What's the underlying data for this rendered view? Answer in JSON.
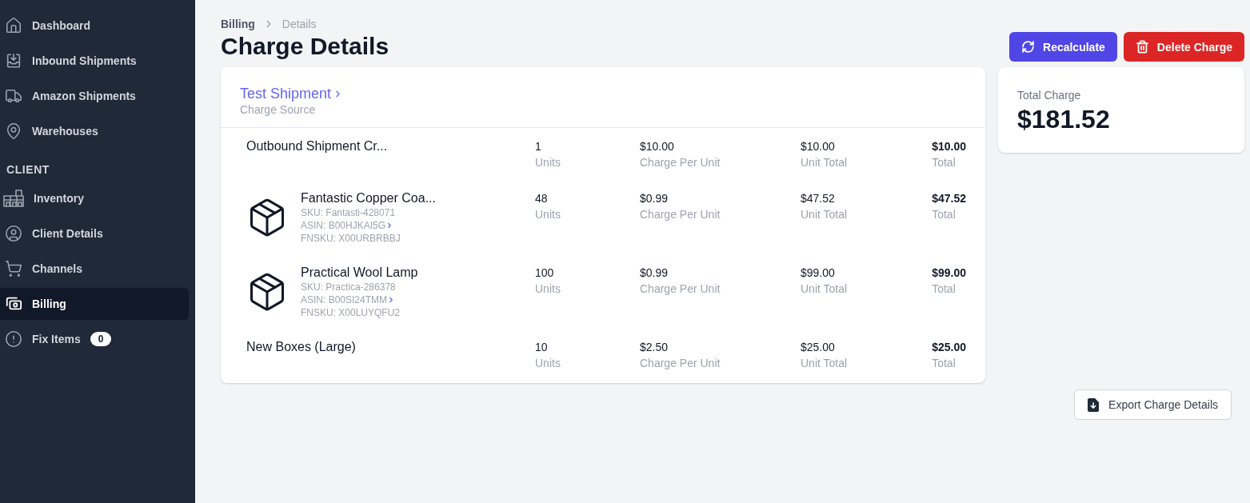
{
  "sidebar": {
    "groups": [
      {
        "items": [
          {
            "label": "Dashboard",
            "selected": false
          },
          {
            "label": "Inbound Shipments",
            "selected": false
          },
          {
            "label": "Amazon Shipments",
            "selected": false
          },
          {
            "label": "Warehouses",
            "selected": false
          }
        ]
      },
      {
        "heading": "CLIENT",
        "items": [
          {
            "label": "Inventory",
            "selected": false
          },
          {
            "label": "Client Details",
            "selected": false
          },
          {
            "label": "Channels",
            "selected": false
          },
          {
            "label": "Billing",
            "selected": true
          },
          {
            "label": "Fix Items",
            "selected": false,
            "badge": "0"
          }
        ]
      }
    ]
  },
  "breadcrumb": [
    "Billing",
    "Details"
  ],
  "title": "Charge Details",
  "actions": [
    {
      "label": "Recalculate",
      "kind": "primary"
    },
    {
      "label": "Delete Charge",
      "kind": "danger"
    }
  ],
  "charge": {
    "source": {
      "link": "Test Shipment",
      "label": "Charge Source"
    },
    "line_items": [
      {
        "kind": "service",
        "name": "Outbound Shipment Cr...",
        "cells": [
          {
            "value": "1",
            "label": "Units"
          },
          {
            "value": "$10.00",
            "label": "Charge Per Unit"
          },
          {
            "value": "$10.00",
            "label": "Unit Total"
          },
          {
            "value": "$10.00",
            "label": "Total"
          }
        ]
      },
      {
        "kind": "product",
        "name": "Fantastic Copper Coa...",
        "sku": "SKU: Fantasti-428071",
        "asin": "ASIN: B00HJKAI5G",
        "fnsku": "FNSKU: X00URBRBBJ",
        "cells": [
          {
            "value": "48",
            "label": "Units"
          },
          {
            "value": "$0.99",
            "label": "Charge Per Unit"
          },
          {
            "value": "$47.52",
            "label": "Unit Total"
          },
          {
            "value": "$47.52",
            "label": "Total"
          }
        ]
      },
      {
        "kind": "product",
        "name": "Practical Wool Lamp",
        "sku": "SKU: Practica-286378",
        "asin": "ASIN: B00SI24TMM",
        "fnsku": "FNSKU: X00LUYQFU2",
        "cells": [
          {
            "value": "100",
            "label": "Units"
          },
          {
            "value": "$0.99",
            "label": "Charge Per Unit"
          },
          {
            "value": "$99.00",
            "label": "Unit Total"
          },
          {
            "value": "$99.00",
            "label": "Total"
          }
        ]
      },
      {
        "kind": "service",
        "name": "New Boxes (Large)",
        "cells": [
          {
            "value": "10",
            "label": "Units"
          },
          {
            "value": "$2.50",
            "label": "Charge Per Unit"
          },
          {
            "value": "$25.00",
            "label": "Unit Total"
          },
          {
            "value": "$25.00",
            "label": "Total"
          }
        ]
      }
    ]
  },
  "total": {
    "label": "Total Charge",
    "value": "$181.52"
  },
  "export_button": "Export Charge Details"
}
